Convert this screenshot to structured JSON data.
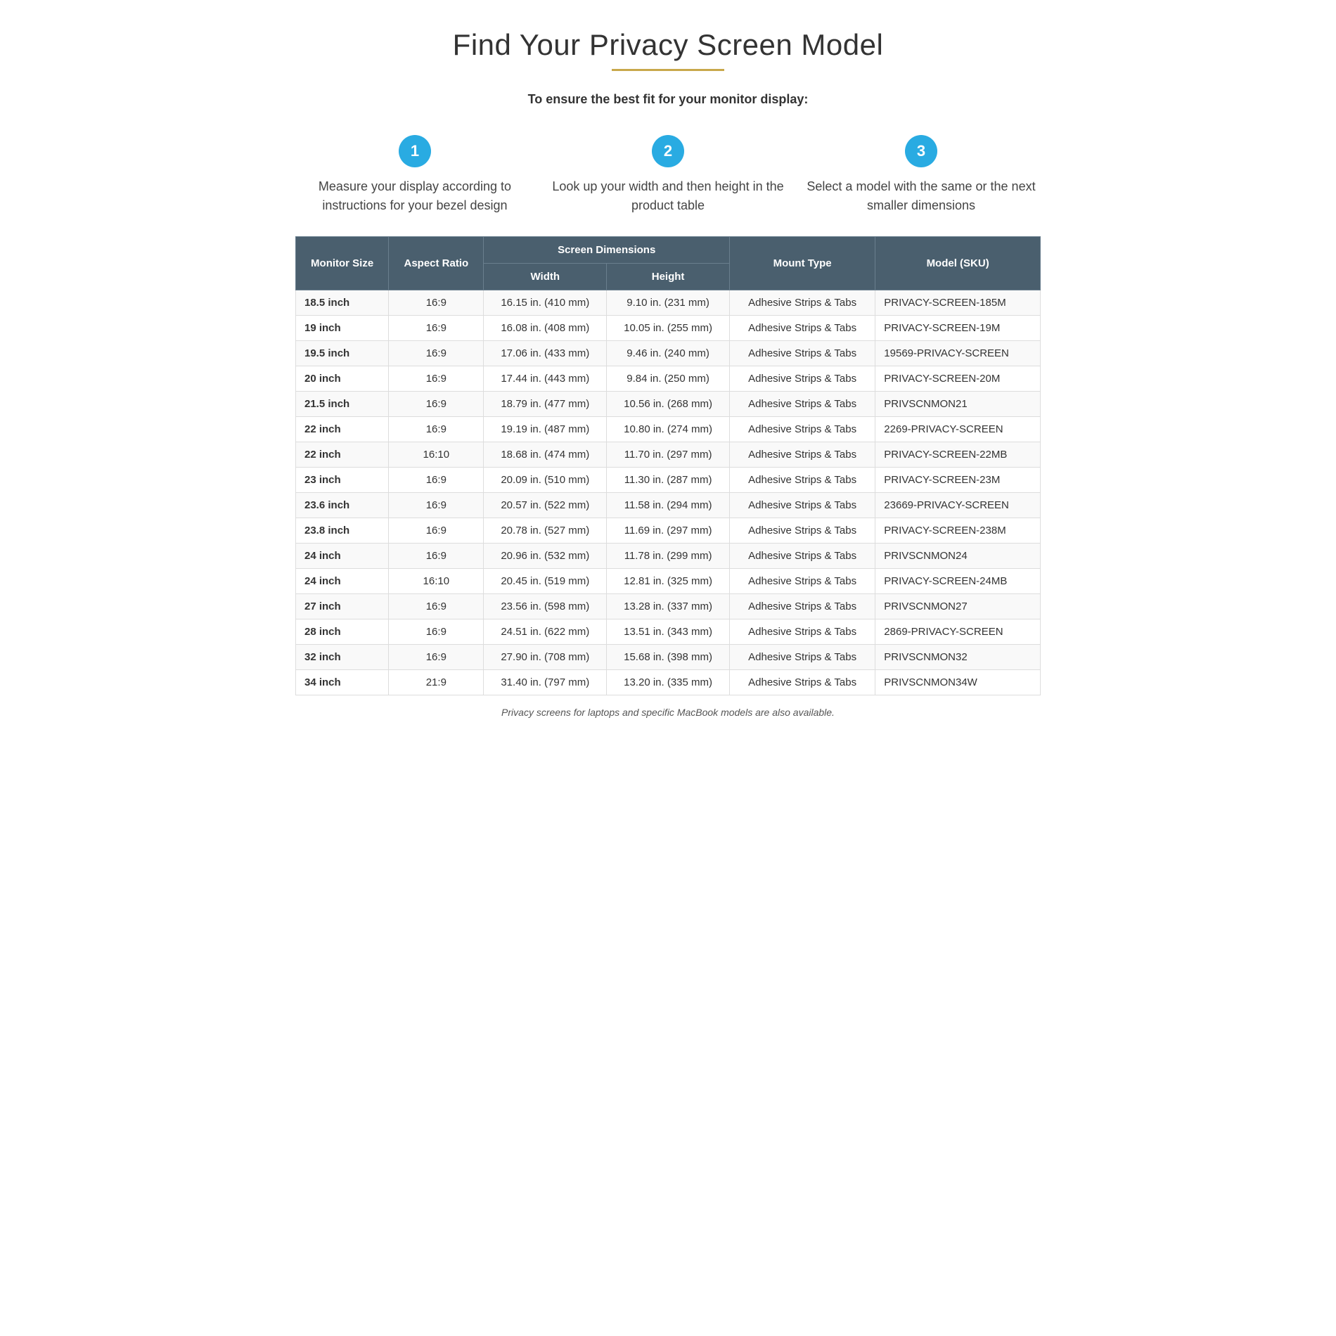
{
  "title": "Find Your Privacy Screen Model",
  "subtitle": "To ensure the best fit for your monitor display:",
  "steps": [
    {
      "number": "1",
      "text": "Measure your display according to instructions for your bezel design"
    },
    {
      "number": "2",
      "text": "Look up your width and then height in the product table"
    },
    {
      "number": "3",
      "text": "Select a model with the same or the next smaller dimensions"
    }
  ],
  "table": {
    "headers": {
      "col1": "Monitor Size",
      "col2": "Aspect Ratio",
      "screenDimensions": "Screen Dimensions",
      "col3": "Width",
      "col4": "Height",
      "col5": "Mount Type",
      "col6": "Model (SKU)"
    },
    "rows": [
      {
        "size": "18.5 inch",
        "ratio": "16:9",
        "width": "16.15 in. (410 mm)",
        "height": "9.10 in. (231 mm)",
        "mount": "Adhesive Strips & Tabs",
        "model": "PRIVACY-SCREEN-185M"
      },
      {
        "size": "19 inch",
        "ratio": "16:9",
        "width": "16.08 in. (408 mm)",
        "height": "10.05 in. (255 mm)",
        "mount": "Adhesive Strips & Tabs",
        "model": "PRIVACY-SCREEN-19M"
      },
      {
        "size": "19.5 inch",
        "ratio": "16:9",
        "width": "17.06 in. (433 mm)",
        "height": "9.46 in. (240 mm)",
        "mount": "Adhesive Strips & Tabs",
        "model": "19569-PRIVACY-SCREEN"
      },
      {
        "size": "20 inch",
        "ratio": "16:9",
        "width": "17.44 in. (443 mm)",
        "height": "9.84 in. (250 mm)",
        "mount": "Adhesive Strips & Tabs",
        "model": "PRIVACY-SCREEN-20M"
      },
      {
        "size": "21.5 inch",
        "ratio": "16:9",
        "width": "18.79 in. (477 mm)",
        "height": "10.56 in. (268 mm)",
        "mount": "Adhesive Strips & Tabs",
        "model": "PRIVSCNMON21"
      },
      {
        "size": "22 inch",
        "ratio": "16:9",
        "width": "19.19 in. (487 mm)",
        "height": "10.80 in. (274 mm)",
        "mount": "Adhesive Strips & Tabs",
        "model": "2269-PRIVACY-SCREEN"
      },
      {
        "size": "22 inch",
        "ratio": "16:10",
        "width": "18.68 in. (474 mm)",
        "height": "11.70 in. (297 mm)",
        "mount": "Adhesive Strips & Tabs",
        "model": "PRIVACY-SCREEN-22MB"
      },
      {
        "size": "23 inch",
        "ratio": "16:9",
        "width": "20.09 in. (510 mm)",
        "height": "11.30 in. (287 mm)",
        "mount": "Adhesive Strips & Tabs",
        "model": "PRIVACY-SCREEN-23M"
      },
      {
        "size": "23.6 inch",
        "ratio": "16:9",
        "width": "20.57 in. (522 mm)",
        "height": "11.58 in. (294 mm)",
        "mount": "Adhesive Strips & Tabs",
        "model": "23669-PRIVACY-SCREEN"
      },
      {
        "size": "23.8 inch",
        "ratio": "16:9",
        "width": "20.78 in. (527 mm)",
        "height": "11.69 in. (297 mm)",
        "mount": "Adhesive Strips & Tabs",
        "model": "PRIVACY-SCREEN-238M"
      },
      {
        "size": "24 inch",
        "ratio": "16:9",
        "width": "20.96 in. (532 mm)",
        "height": "11.78 in. (299 mm)",
        "mount": "Adhesive Strips & Tabs",
        "model": "PRIVSCNMON24"
      },
      {
        "size": "24 inch",
        "ratio": "16:10",
        "width": "20.45 in. (519 mm)",
        "height": "12.81 in. (325 mm)",
        "mount": "Adhesive Strips & Tabs",
        "model": "PRIVACY-SCREEN-24MB"
      },
      {
        "size": "27 inch",
        "ratio": "16:9",
        "width": "23.56 in. (598 mm)",
        "height": "13.28 in. (337 mm)",
        "mount": "Adhesive Strips & Tabs",
        "model": "PRIVSCNMON27"
      },
      {
        "size": "28 inch",
        "ratio": "16:9",
        "width": "24.51 in. (622 mm)",
        "height": "13.51 in. (343 mm)",
        "mount": "Adhesive Strips & Tabs",
        "model": "2869-PRIVACY-SCREEN"
      },
      {
        "size": "32 inch",
        "ratio": "16:9",
        "width": "27.90 in. (708 mm)",
        "height": "15.68 in. (398 mm)",
        "mount": "Adhesive Strips & Tabs",
        "model": "PRIVSCNMON32"
      },
      {
        "size": "34 inch",
        "ratio": "21:9",
        "width": "31.40 in. (797 mm)",
        "height": "13.20 in. (335 mm)",
        "mount": "Adhesive Strips & Tabs",
        "model": "PRIVSCNMON34W"
      }
    ]
  },
  "footer": "Privacy screens for laptops and specific MacBook models are also available."
}
